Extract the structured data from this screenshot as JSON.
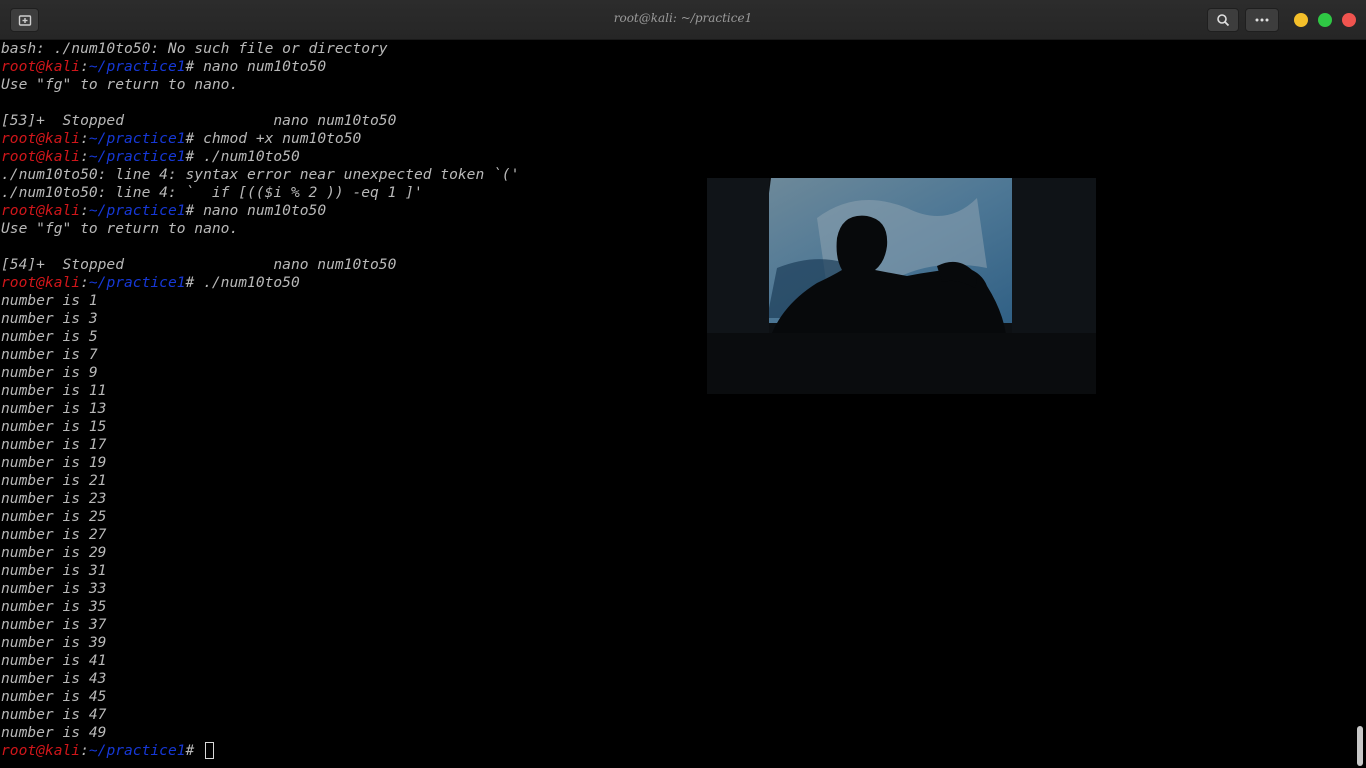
{
  "window": {
    "title": "root@kali: ~/practice1"
  },
  "colors": {
    "user": "#d0161a",
    "path": "#1638d6",
    "text": "#b8b8b8",
    "background": "#000000"
  },
  "prompt": {
    "user_host": "root@kali",
    "colon": ":",
    "path": "~/practice1",
    "symbol": "# "
  },
  "lines": [
    {
      "text": "bash: ./num10to50: No such file or directory"
    },
    {
      "cmd": "nano num10to50"
    },
    {
      "text": "Use \"fg\" to return to nano."
    },
    {
      "text": ""
    },
    {
      "text": "[53]+  Stopped                 nano num10to50"
    },
    {
      "cmd": "chmod +x num10to50"
    },
    {
      "cmd": "./num10to50"
    },
    {
      "text": "./num10to50: line 4: syntax error near unexpected token `('"
    },
    {
      "text": "./num10to50: line 4: `  if [(($i % 2 )) -eq 1 ]'"
    },
    {
      "cmd": "nano num10to50"
    },
    {
      "text": "Use \"fg\" to return to nano."
    },
    {
      "text": ""
    },
    {
      "text": "[54]+  Stopped                 nano num10to50"
    },
    {
      "cmd": "./num10to50"
    },
    {
      "text": "number is 1"
    },
    {
      "text": "number is 3"
    },
    {
      "text": "number is 5"
    },
    {
      "text": "number is 7"
    },
    {
      "text": "number is 9"
    },
    {
      "text": "number is 11"
    },
    {
      "text": "number is 13"
    },
    {
      "text": "number is 15"
    },
    {
      "text": "number is 17"
    },
    {
      "text": "number is 19"
    },
    {
      "text": "number is 21"
    },
    {
      "text": "number is 23"
    },
    {
      "text": "number is 25"
    },
    {
      "text": "number is 27"
    },
    {
      "text": "number is 29"
    },
    {
      "text": "number is 31"
    },
    {
      "text": "number is 33"
    },
    {
      "text": "number is 35"
    },
    {
      "text": "number is 37"
    },
    {
      "text": "number is 39"
    },
    {
      "text": "number is 41"
    },
    {
      "text": "number is 43"
    },
    {
      "text": "number is 45"
    },
    {
      "text": "number is 47"
    },
    {
      "text": "number is 49"
    },
    {
      "cmd": "",
      "cursor": true
    }
  ]
}
